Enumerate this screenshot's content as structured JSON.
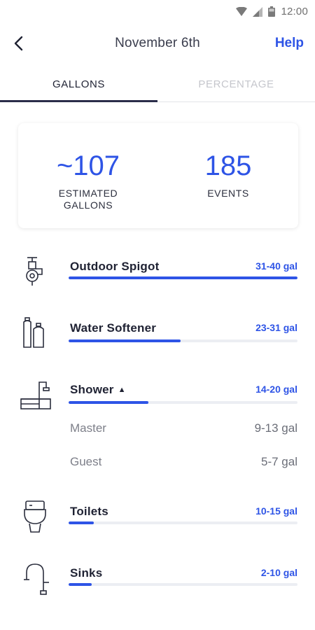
{
  "status_bar": {
    "time": "12:00"
  },
  "header": {
    "title": "November 6th",
    "help_label": "Help"
  },
  "tabs": [
    {
      "label": "GALLONS",
      "active": true
    },
    {
      "label": "PERCENTAGE",
      "active": false
    }
  ],
  "summary": {
    "gallons_value": "~107",
    "gallons_label_1": "ESTIMATED",
    "gallons_label_2": "GALLONS",
    "events_value": "185",
    "events_label": "EVENTS"
  },
  "colors": {
    "accent": "#2e54e6",
    "track": "#eceef3",
    "text": "#1f2233",
    "muted": "#7d7f89"
  },
  "categories": [
    {
      "name": "Outdoor Spigot",
      "range": "31-40 gal",
      "icon": "outdoor-spigot-icon",
      "fill": 1.0
    },
    {
      "name": "Water Softener",
      "range": "23-31 gal",
      "icon": "water-softener-icon",
      "fill": 0.49
    },
    {
      "name": "Shower",
      "range": "14-20 gal",
      "icon": "shower-icon",
      "fill": 0.35,
      "children": [
        {
          "name": "Master",
          "range": "9-13 gal"
        },
        {
          "name": "Guest",
          "range": "5-7 gal"
        }
      ]
    },
    {
      "name": "Toilets",
      "range": "10-15 gal",
      "icon": "toilet-icon",
      "fill": 0.11
    },
    {
      "name": "Sinks",
      "range": "2-10 gal",
      "icon": "sink-icon",
      "fill": 0.1
    }
  ]
}
